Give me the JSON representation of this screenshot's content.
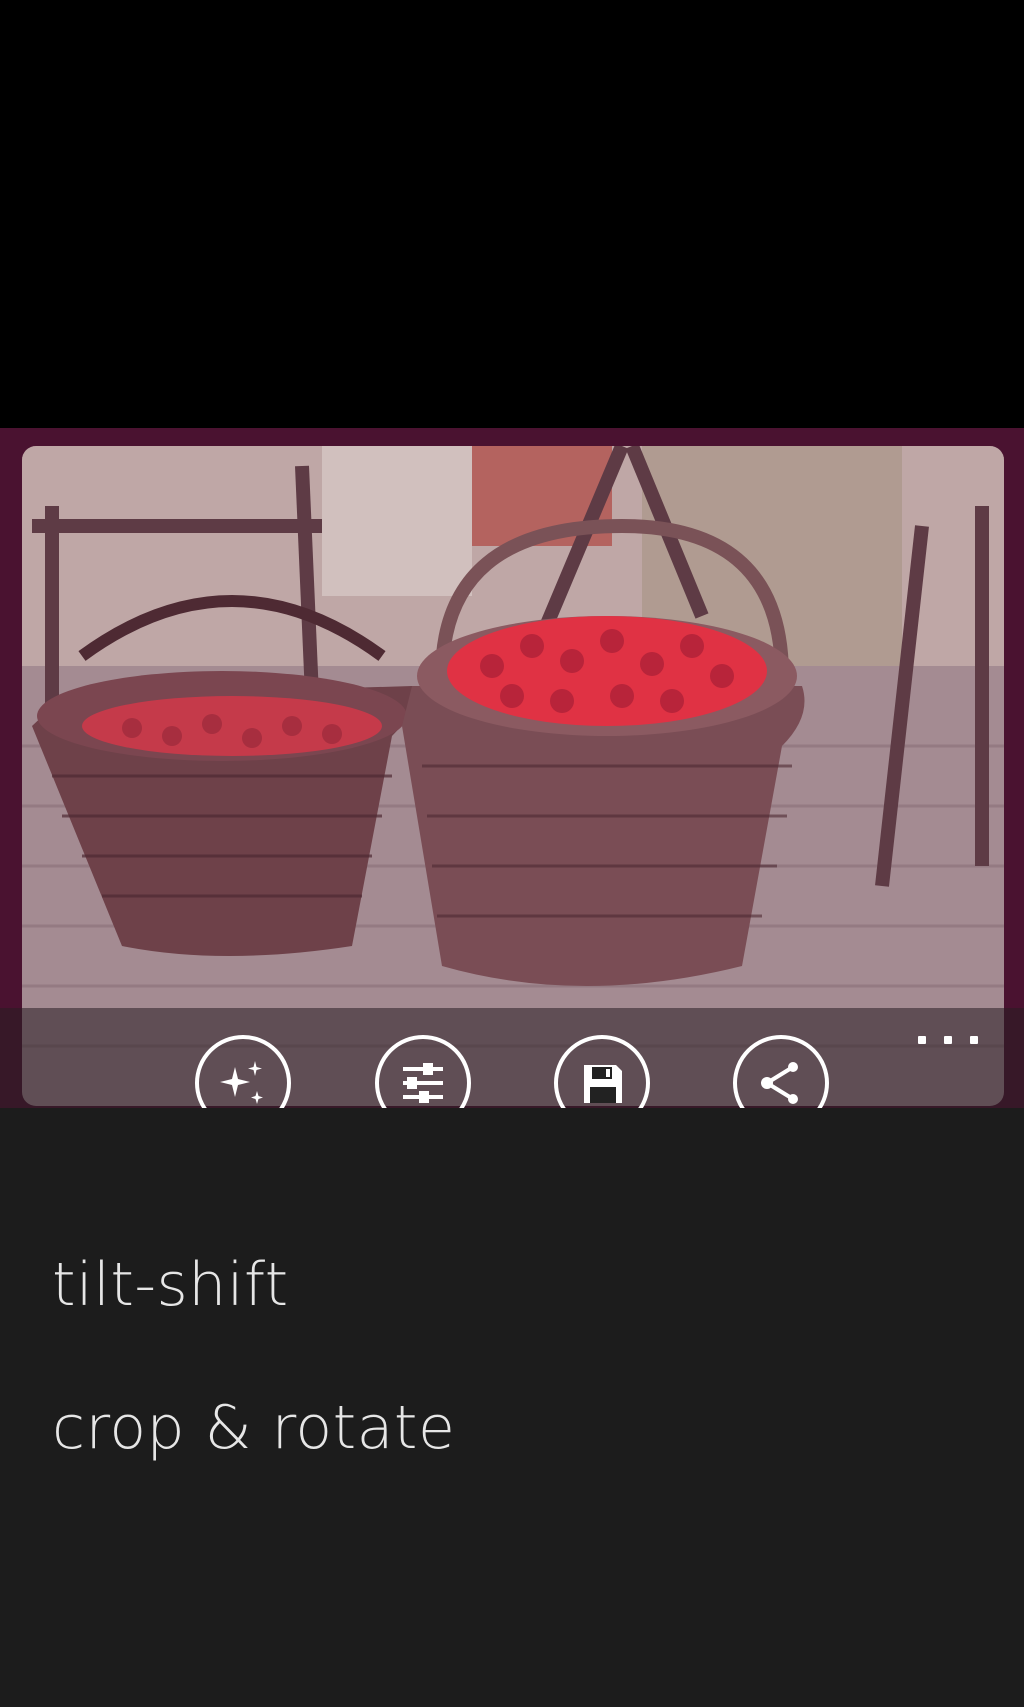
{
  "photo": {
    "description_icon": "cherry-baskets-photo"
  },
  "app_bar": {
    "actions": [
      {
        "label": "effects",
        "icon": "sparkle-icon"
      },
      {
        "label": "adjust",
        "icon": "sliders-icon"
      },
      {
        "label": "save",
        "icon": "floppy-disk-icon"
      },
      {
        "label": "share",
        "icon": "share-icon"
      }
    ],
    "more_icon": "ellipsis-icon"
  },
  "menu": {
    "items": [
      {
        "label": "tilt-shift"
      },
      {
        "label": "crop & rotate"
      }
    ]
  },
  "colors": {
    "frame": "#4a1230",
    "panel": "#1c1c1c",
    "text": "#ffffff"
  }
}
